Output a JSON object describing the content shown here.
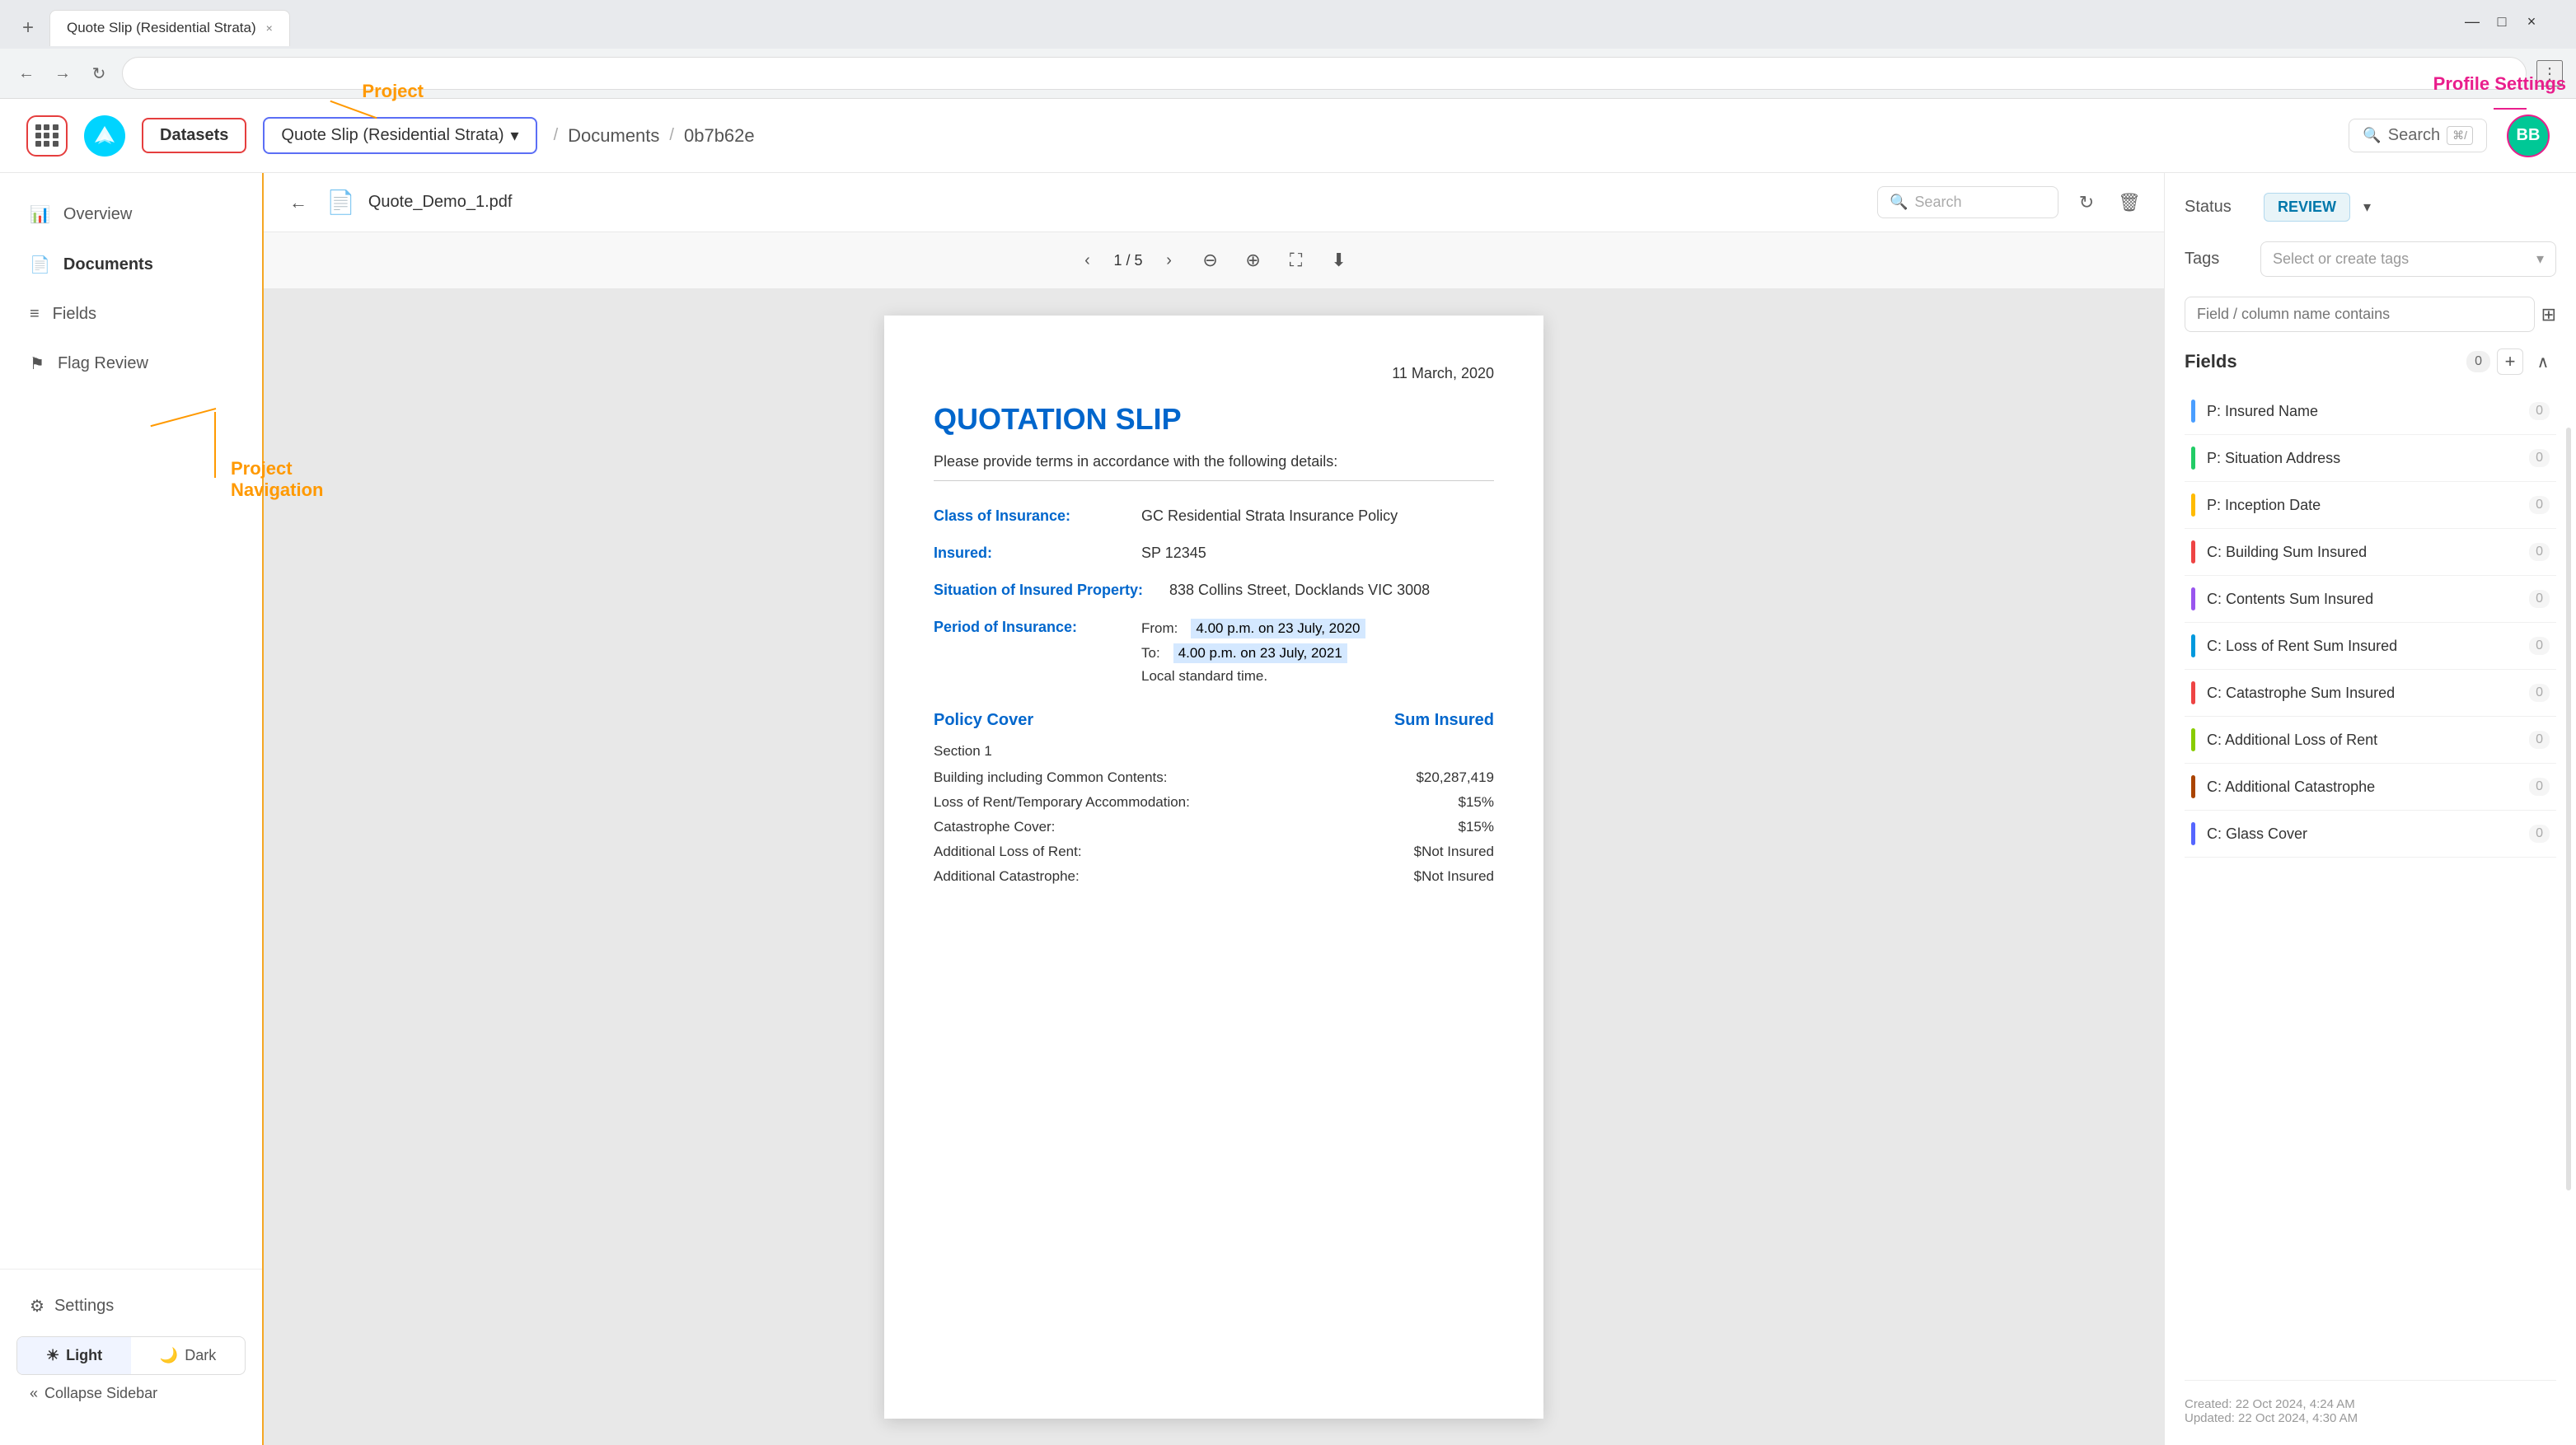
{
  "browser": {
    "tab_title": "Quote Slip (Residential Strata)",
    "new_tab_label": "+",
    "back_label": "←",
    "forward_label": "→",
    "refresh_label": "↻",
    "menu_label": "⋮",
    "minimize_label": "—",
    "maximize_label": "□",
    "close_label": "×"
  },
  "topnav": {
    "datasets_label": "Datasets",
    "project_label": "Quote Slip (Residential Strata)",
    "documents_label": "Documents",
    "doc_id_label": "0b7b62e",
    "search_label": "Search",
    "search_kbd": "⌘/",
    "avatar_initials": "BB",
    "profile_annotation": "Profile Settings",
    "project_annotation": "Project",
    "project_annotation_nav": "Project\nNavigation"
  },
  "sidebar": {
    "items": [
      {
        "id": "overview",
        "icon": "📊",
        "label": "Overview"
      },
      {
        "id": "documents",
        "icon": "📄",
        "label": "Documents"
      },
      {
        "id": "fields",
        "icon": "≡",
        "label": "Fields"
      },
      {
        "id": "flag-review",
        "icon": "⚑",
        "label": "Flag Review"
      }
    ],
    "settings_label": "Settings",
    "theme_light_label": "Light",
    "theme_dark_label": "Dark",
    "collapse_label": "Collapse Sidebar"
  },
  "doc_toolbar": {
    "back_label": "←",
    "doc_name": "Quote_Demo_1.pdf",
    "search_placeholder": "Search",
    "refresh_label": "↻",
    "delete_label": "🗑"
  },
  "doc_page_controls": {
    "prev_label": "‹",
    "next_label": "›",
    "current_page": "1",
    "total_pages": "5",
    "zoom_out_label": "⊖",
    "zoom_in_label": "⊕",
    "fullscreen_label": "⛶",
    "download_label": "⬇"
  },
  "document": {
    "date": "11 March, 2020",
    "title": "QUOTATION SLIP",
    "subtitle": "Please provide terms in accordance with the following details:",
    "fields": [
      {
        "label": "Class of Insurance:",
        "value": "GC Residential Strata Insurance Policy"
      },
      {
        "label": "Insured:",
        "value": "SP 12345"
      },
      {
        "label": "Situation of Insured Property:",
        "value": "838 Collins Street, Docklands VIC 3008"
      },
      {
        "label": "Period of Insurance:",
        "value_from": "From:   4.00 p.m. on 23 July, 2020",
        "value_to": "To:       4.00 p.m. on 23 July, 2021",
        "value_note": "Local standard time."
      }
    ],
    "policy_cover_header": "Policy Cover",
    "sum_insured_header": "Sum Insured",
    "section_label": "Section 1",
    "rows": [
      {
        "item": "Building including Common Contents:",
        "value": "$20,287,419"
      },
      {
        "item": "Loss of Rent/Temporary Accommodation:",
        "value": "$15%"
      },
      {
        "item": "Catastrophe Cover:",
        "value": "$15%"
      },
      {
        "item": "Additional Loss of Rent:",
        "value": "$Not Insured"
      },
      {
        "item": "Additional Catastrophe:",
        "value": "$Not Insured"
      }
    ]
  },
  "right_panel": {
    "status_label": "Status",
    "status_value": "REVIEW",
    "tags_label": "Tags",
    "tags_placeholder": "Select or create tags",
    "filter_placeholder": "Field / column name contains",
    "fields_title": "Fields",
    "fields_count": "0",
    "add_field_label": "+",
    "collapse_label": "∧",
    "fields": [
      {
        "name": "P: Insured Name",
        "count": "0",
        "color": "#4a9eff"
      },
      {
        "name": "P: Situation Address",
        "count": "0",
        "color": "#22cc66"
      },
      {
        "name": "P: Inception Date",
        "count": "0",
        "color": "#ffbb00"
      },
      {
        "name": "C: Building Sum Insured",
        "count": "0",
        "color": "#ee4444"
      },
      {
        "name": "C: Contents Sum Insured",
        "count": "0",
        "color": "#9955ee"
      },
      {
        "name": "C: Loss of Rent Sum Insured",
        "count": "0",
        "color": "#0099dd"
      },
      {
        "name": "C: Catastrophe Sum Insured",
        "count": "0",
        "color": "#ee4444"
      },
      {
        "name": "C: Additional Loss of Rent",
        "count": "0",
        "color": "#88cc00"
      },
      {
        "name": "C: Additional Catastrophe",
        "count": "0",
        "color": "#aa4400"
      },
      {
        "name": "C: Glass Cover",
        "count": "0",
        "color": "#5566ff"
      }
    ],
    "footer_created": "Created: 22 Oct 2024, 4:24 AM",
    "footer_updated": "Updated: 22 Oct 2024, 4:30 AM"
  }
}
